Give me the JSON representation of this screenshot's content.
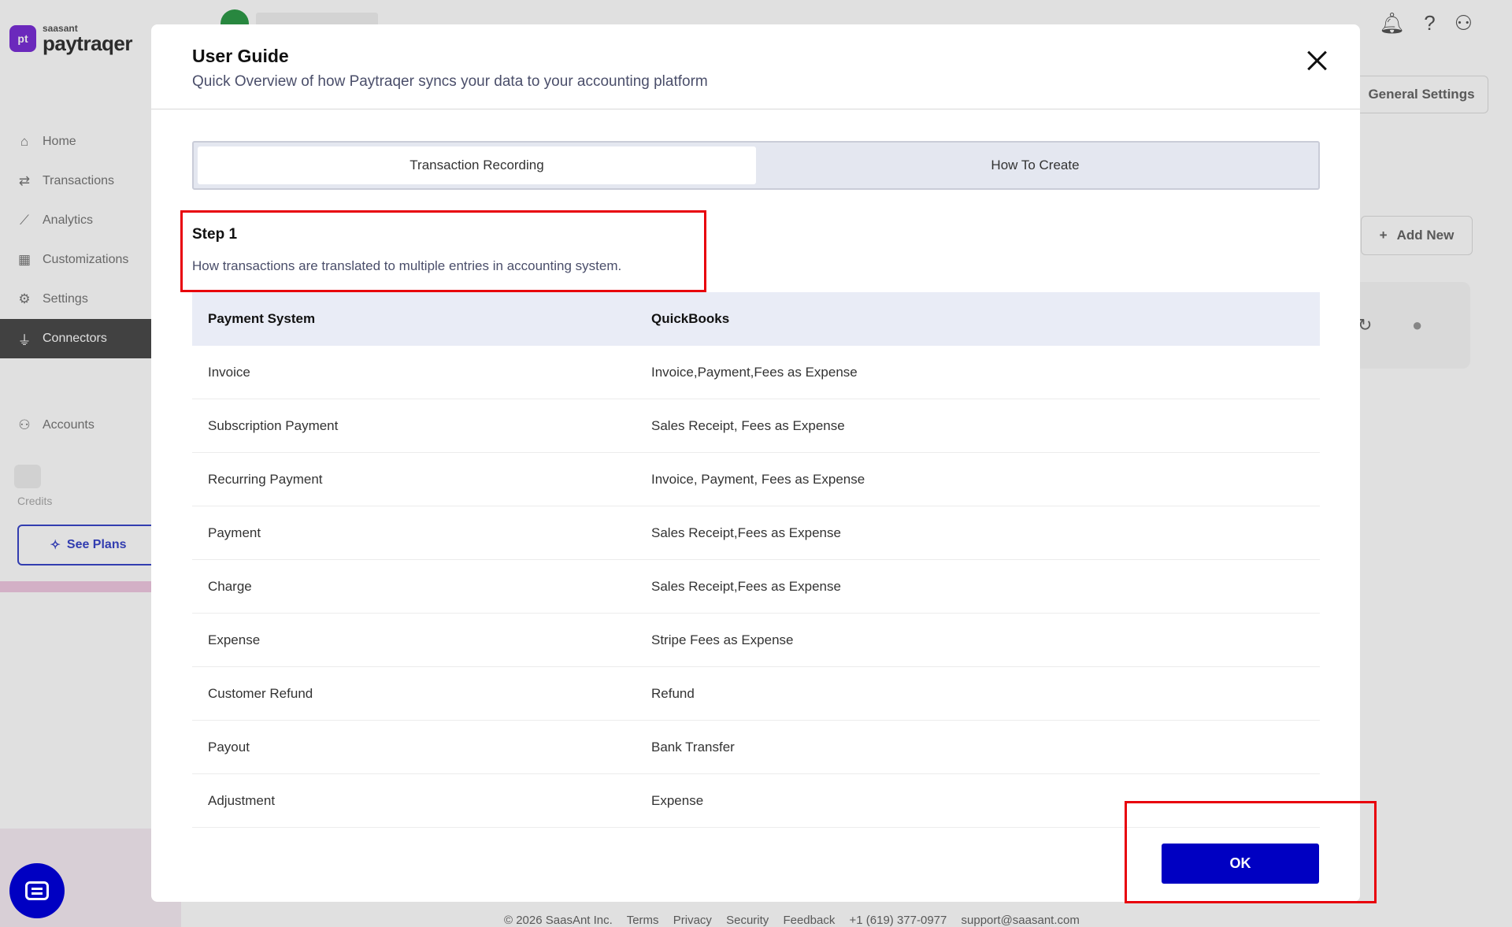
{
  "app": {
    "logo_small": "saasant",
    "logo_big": "paytraqer",
    "logo_mark": "pt"
  },
  "sidebar": {
    "items": [
      {
        "label": "Home",
        "icon": "home-icon"
      },
      {
        "label": "Transactions",
        "icon": "transfer-icon"
      },
      {
        "label": "Analytics",
        "icon": "chart-icon"
      },
      {
        "label": "Customizations",
        "icon": "grid-icon"
      },
      {
        "label": "Settings",
        "icon": "gear-icon"
      },
      {
        "label": "Connectors",
        "icon": "plug-icon",
        "active": true
      }
    ],
    "accounts_label": "Accounts",
    "credits_label": "Credits",
    "see_plans_label": "See Plans"
  },
  "header": {
    "general_settings_label": "General Settings",
    "add_new_label": "Add New"
  },
  "footer": {
    "copyright": "© 2026 SaasAnt Inc.",
    "links": [
      "Terms",
      "Privacy",
      "Security",
      "Feedback"
    ],
    "phone": "+1 (619) 377-0977",
    "email": "support@saasant.com"
  },
  "modal": {
    "title": "User Guide",
    "subtitle": "Quick Overview of how Paytraqer syncs your data to your accounting platform",
    "tabs": [
      {
        "label": "Transaction Recording",
        "active": true
      },
      {
        "label": "How To Create",
        "active": false
      }
    ],
    "step": {
      "title": "Step 1",
      "description": "How transactions are translated to multiple entries in accounting system."
    },
    "table": {
      "headers": [
        "Payment System",
        "QuickBooks"
      ],
      "rows": [
        [
          "Invoice",
          "Invoice,Payment,Fees as Expense"
        ],
        [
          "Subscription Payment",
          "Sales Receipt, Fees as Expense"
        ],
        [
          "Recurring Payment",
          "Invoice, Payment, Fees as Expense"
        ],
        [
          "Payment",
          "Sales Receipt,Fees as Expense"
        ],
        [
          "Charge",
          "Sales Receipt,Fees as Expense"
        ],
        [
          "Expense",
          "Stripe Fees as Expense"
        ],
        [
          "Customer Refund",
          "Refund"
        ],
        [
          "Payout",
          "Bank Transfer"
        ],
        [
          "Adjustment",
          "Expense"
        ]
      ]
    },
    "ok_label": "OK"
  },
  "colors": {
    "primary": "#0000c2",
    "highlight": "#e8000b",
    "brand": "#7a2fd6"
  }
}
